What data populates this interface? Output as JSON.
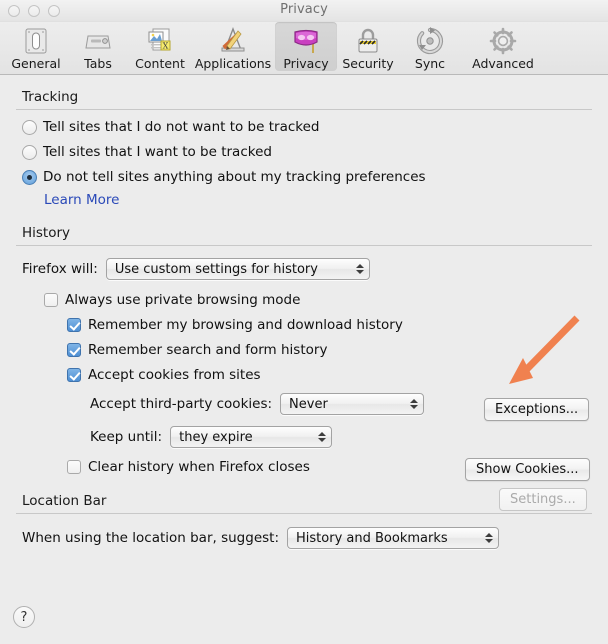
{
  "window": {
    "title": "Privacy",
    "traffic_lights": [
      "close-button",
      "minimize-button",
      "zoom-button"
    ]
  },
  "toolbar": {
    "selected": "Privacy",
    "tabs": [
      {
        "label": "General",
        "icon": "general-icon"
      },
      {
        "label": "Tabs",
        "icon": "tabs-icon"
      },
      {
        "label": "Content",
        "icon": "content-icon"
      },
      {
        "label": "Applications",
        "icon": "applications-icon"
      },
      {
        "label": "Privacy",
        "icon": "privacy-mask-icon"
      },
      {
        "label": "Security",
        "icon": "security-lock-icon"
      },
      {
        "label": "Sync",
        "icon": "sync-icon"
      },
      {
        "label": "Advanced",
        "icon": "advanced-gear-icon"
      }
    ]
  },
  "tracking": {
    "heading": "Tracking",
    "options": [
      {
        "label": "Tell sites that I do not want to be tracked",
        "selected": false
      },
      {
        "label": "Tell sites that I want to be tracked",
        "selected": false
      },
      {
        "label": "Do not tell sites anything about my tracking preferences",
        "selected": true
      }
    ],
    "learn_more": "Learn More"
  },
  "history": {
    "heading": "History",
    "firefox_will_label": "Firefox will:",
    "firefox_will_value": "Use custom settings for history",
    "checkboxes": [
      {
        "label": "Always use private browsing mode",
        "checked": false
      },
      {
        "label": "Remember my browsing and download history",
        "checked": true
      },
      {
        "label": "Remember search and form history",
        "checked": true
      },
      {
        "label": "Accept cookies from sites",
        "checked": true
      },
      {
        "label": "Clear history when Firefox closes",
        "checked": false
      }
    ],
    "third_party_label": "Accept third-party cookies:",
    "third_party_value": "Never",
    "keep_until_label": "Keep until:",
    "keep_until_value": "they expire",
    "buttons": {
      "exceptions": "Exceptions...",
      "show_cookies": "Show Cookies...",
      "settings": "Settings..."
    }
  },
  "location_bar": {
    "heading": "Location Bar",
    "suggest_label": "When using the location bar, suggest:",
    "suggest_value": "History and Bookmarks"
  },
  "help": {
    "label": "?"
  },
  "annotation": {
    "type": "arrow",
    "color": "#f0814f",
    "points_to": "Exceptions..."
  }
}
